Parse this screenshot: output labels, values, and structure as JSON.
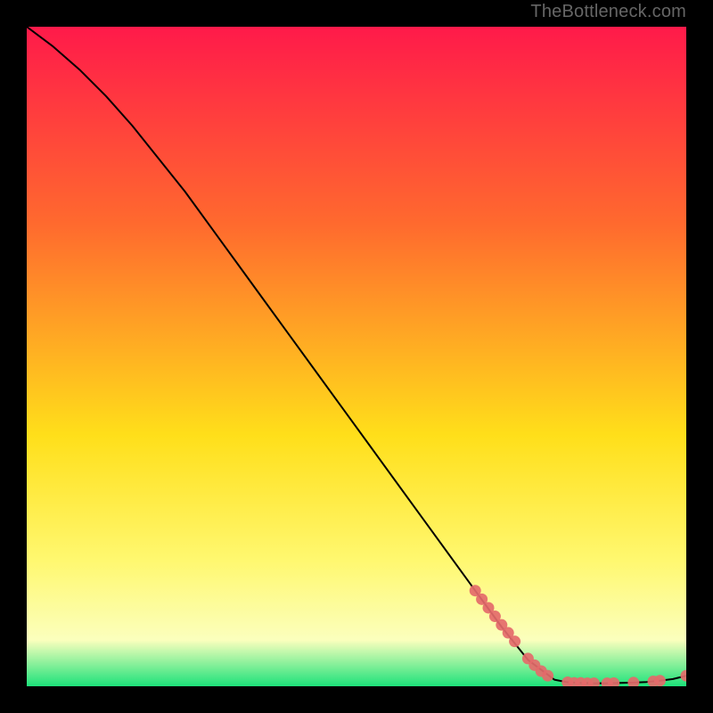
{
  "attribution": "TheBottleneck.com",
  "colors": {
    "gradient_top": "#ff1a4a",
    "gradient_mid1": "#ff6a2e",
    "gradient_mid2": "#ffdf1a",
    "gradient_mid3": "#fff870",
    "gradient_mid4": "#fbffbd",
    "gradient_bottom": "#1de27a",
    "curve": "#000000",
    "marker": "#e46a6a",
    "frame": "#000000"
  },
  "chart_data": {
    "type": "line",
    "title": "",
    "xlabel": "",
    "ylabel": "",
    "xlim": [
      0,
      100
    ],
    "ylim": [
      0,
      100
    ],
    "grid": false,
    "legend": false,
    "series": [
      {
        "name": "bottleneck-curve",
        "x": [
          0,
          4,
          8,
          12,
          16,
          20,
          24,
          28,
          32,
          36,
          40,
          44,
          48,
          52,
          56,
          60,
          64,
          68,
          72,
          76,
          80,
          82,
          84,
          86,
          88,
          90,
          92,
          94,
          96,
          98,
          100
        ],
        "y": [
          100,
          97,
          93.5,
          89.5,
          85,
          80,
          75,
          69.5,
          64,
          58.5,
          53,
          47.5,
          42,
          36.5,
          31,
          25.5,
          20,
          14.5,
          9,
          4,
          1,
          0.6,
          0.5,
          0.45,
          0.45,
          0.5,
          0.55,
          0.65,
          0.85,
          1.1,
          1.6
        ]
      }
    ],
    "markers": [
      {
        "x": 68,
        "y": 14.5
      },
      {
        "x": 69,
        "y": 13.2
      },
      {
        "x": 70,
        "y": 11.9
      },
      {
        "x": 71,
        "y": 10.6
      },
      {
        "x": 72,
        "y": 9.3
      },
      {
        "x": 73,
        "y": 8.1
      },
      {
        "x": 74,
        "y": 6.8
      },
      {
        "x": 76,
        "y": 4.2
      },
      {
        "x": 77,
        "y": 3.2
      },
      {
        "x": 78,
        "y": 2.3
      },
      {
        "x": 79,
        "y": 1.6
      },
      {
        "x": 82,
        "y": 0.6
      },
      {
        "x": 83,
        "y": 0.5
      },
      {
        "x": 84,
        "y": 0.5
      },
      {
        "x": 85,
        "y": 0.45
      },
      {
        "x": 86,
        "y": 0.45
      },
      {
        "x": 88,
        "y": 0.45
      },
      {
        "x": 89,
        "y": 0.48
      },
      {
        "x": 92,
        "y": 0.55
      },
      {
        "x": 95,
        "y": 0.75
      },
      {
        "x": 96,
        "y": 0.85
      },
      {
        "x": 100,
        "y": 1.6
      }
    ]
  }
}
